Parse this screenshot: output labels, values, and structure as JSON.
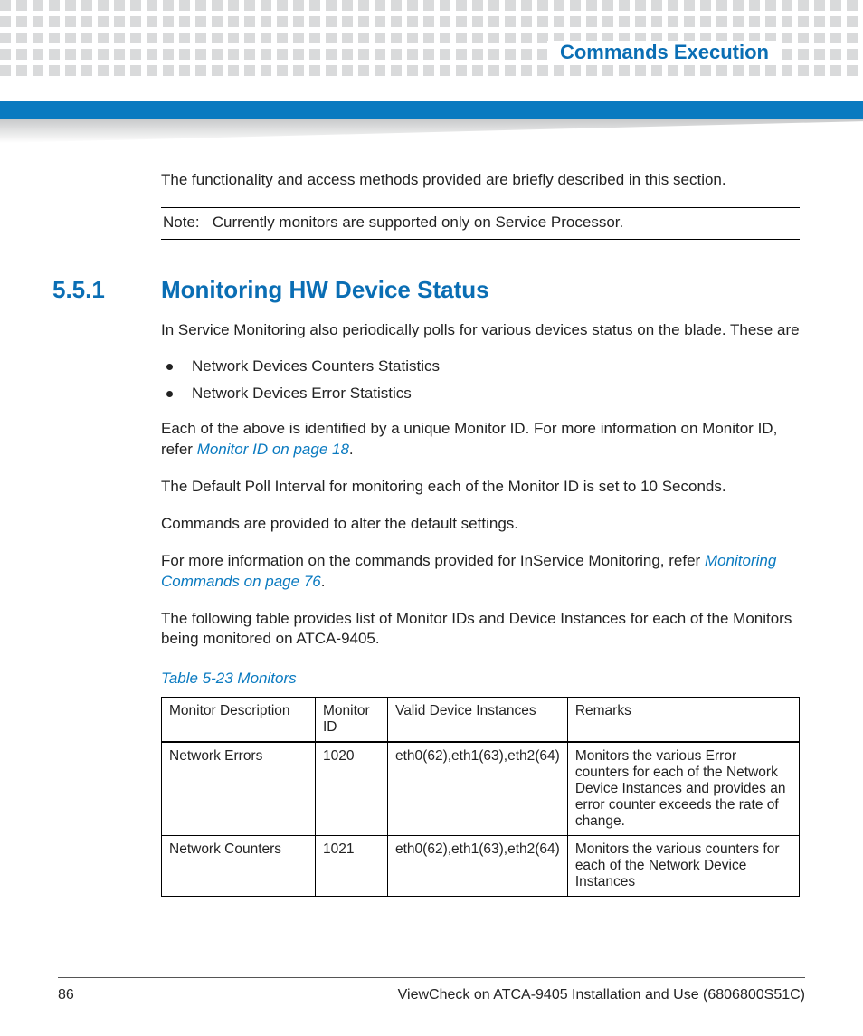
{
  "header": {
    "chapter_title": "Commands Execution"
  },
  "intro_para": "The functionality and access methods provided are briefly described in this section.",
  "note": {
    "label": "Note:",
    "text": "Currently monitors are supported only on Service Processor."
  },
  "section": {
    "number": "5.5.1",
    "title": "Monitoring HW Device Status"
  },
  "body": {
    "p1": " In Service Monitoring also periodically polls for various devices status on the blade. These are",
    "bullets": [
      "Network Devices Counters Statistics",
      "Network Devices Error Statistics"
    ],
    "p2a": "Each of the above is identified by a unique Monitor ID. For more information on Monitor ID, refer ",
    "xref1": "Monitor ID",
    "xref1_suffix": " on page 18",
    "p2b": ".",
    "p3": "The Default Poll Interval for monitoring each of the Monitor ID is set to 10 Seconds.",
    "p4": " Commands are provided to alter the default settings.",
    "p5a": "For more information on the commands provided for InService Monitoring, refer ",
    "xref2": "Monitoring Commands",
    "xref2_suffix": " on page 76",
    "p5b": ".",
    "p6": "The following table provides list of Monitor IDs and Device Instances for each of the Monitors being monitored on ATCA-9405."
  },
  "table": {
    "caption": "Table 5-23 Monitors",
    "headers": {
      "c1": "Monitor Description",
      "c2": "Monitor ID",
      "c3": "Valid Device Instances",
      "c4": "Remarks"
    },
    "rows": [
      {
        "c1": "Network Errors",
        "c2": "1020",
        "c3": "eth0(62),eth1(63),eth2(64)",
        "c4": "Monitors the various Error counters for each of the Network Device Instances and provides an error counter exceeds the rate of change."
      },
      {
        "c1": "Network Counters",
        "c2": "1021",
        "c3": "eth0(62),eth1(63),eth2(64)",
        "c4": "Monitors the various counters for each of the Network Device Instances"
      }
    ]
  },
  "footer": {
    "page": "86",
    "doc": "ViewCheck on ATCA-9405 Installation and Use (6806800S51C)"
  }
}
